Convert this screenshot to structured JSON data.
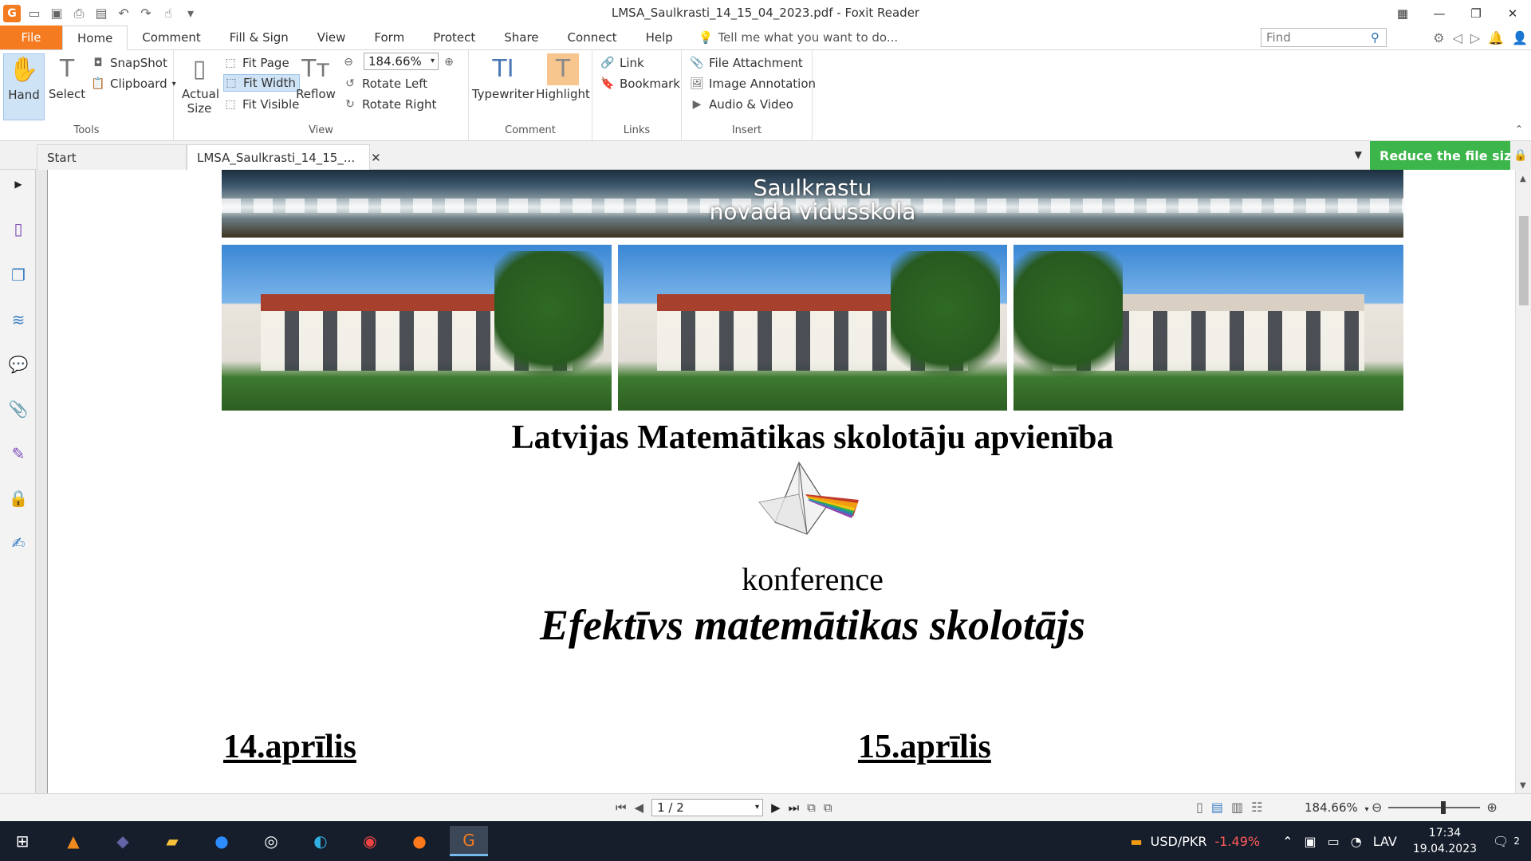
{
  "window": {
    "title": "LMSA_Saulkrasti_14_15_04_2023.pdf - Foxit Reader"
  },
  "ribbon_tabs": [
    "File",
    "Home",
    "Comment",
    "Fill & Sign",
    "View",
    "Form",
    "Protect",
    "Share",
    "Connect",
    "Help"
  ],
  "tell_me": "Tell me what you want to do...",
  "find": {
    "placeholder": "Find"
  },
  "ribbon": {
    "tools": {
      "label": "Tools",
      "hand": "Hand",
      "select": "Select",
      "snapshot": "SnapShot",
      "clipboard": "Clipboard"
    },
    "view": {
      "label": "View",
      "actual_size": "Actual Size",
      "fit_page": "Fit Page",
      "fit_width": "Fit Width",
      "fit_visible": "Fit Visible",
      "reflow": "Reflow",
      "zoom_value": "184.66%",
      "rotate_left": "Rotate Left",
      "rotate_right": "Rotate Right"
    },
    "comment": {
      "label": "Comment",
      "typewriter": "Typewriter",
      "highlight": "Highlight"
    },
    "links": {
      "label": "Links",
      "link": "Link",
      "bookmark": "Bookmark"
    },
    "insert": {
      "label": "Insert",
      "file_attachment": "File Attachment",
      "image_annotation": "Image Annotation",
      "audio_video": "Audio & Video"
    }
  },
  "doc_tabs": [
    {
      "label": "Start"
    },
    {
      "label": "LMSA_Saulkrasti_14_15_..."
    }
  ],
  "promo": {
    "label": "Reduce the file size"
  },
  "document": {
    "banner_line1": "Saulkrastu",
    "banner_line2": "novada vidusskola",
    "heading": "Latvijas Matemātikas skolotāju apvienība",
    "subheading": "konference",
    "title": "Efektīvs matemātikas skolotājs",
    "date1": "14.aprīlis",
    "date2": "15.aprīlis"
  },
  "statusbar": {
    "page_indicator": "1 / 2",
    "zoom": "184.66%"
  },
  "taskbar": {
    "currency": "USD/PKR",
    "change": "-1.49%",
    "lang": "LAV",
    "time": "17:34",
    "date": "19.04.2023",
    "notifications": "2"
  },
  "colors": {
    "accent": "#f47b20",
    "promo": "#3cb54a",
    "taskbar": "#161e2b"
  }
}
